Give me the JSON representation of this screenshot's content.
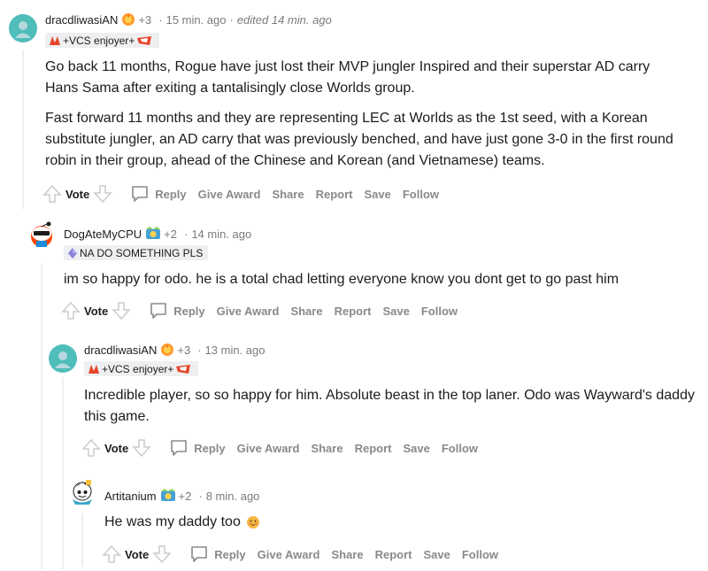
{
  "comments": [
    {
      "author": "dracdliwasiAN",
      "karma": "+3",
      "time": "15 min. ago",
      "edited": "edited 14 min. ago",
      "flair": "+VCS enjoyer+",
      "paragraphs": [
        "Go back 11 months, Rogue have just lost their MVP jungler Inspired and their superstar AD carry Hans Sama after exiting a tantalisingly close Worlds group.",
        "Fast forward 11 months and they are representing LEC at Worlds as the 1st seed, with a Korean substitute jungler, an AD carry that was previously benched, and have just gone 3-0 in the first round robin in their group, ahead of the Chinese and Korean (and Vietnamese) teams."
      ]
    },
    {
      "author": "DogAteMyCPU",
      "karma": "+2",
      "time": "14 min. ago",
      "flair": "NA DO SOMETHING PLS",
      "paragraphs": [
        "im so happy for odo. he is a total chad letting everyone know you dont get to go past him"
      ]
    },
    {
      "author": "dracdliwasiAN",
      "karma": "+3",
      "time": "13 min. ago",
      "flair": "+VCS enjoyer+",
      "paragraphs": [
        "Incredible player, so so happy for him. Absolute beast in the top laner. Odo was Wayward's daddy this game."
      ]
    },
    {
      "author": "Artitanium",
      "karma": "+2",
      "time": "8 min. ago",
      "paragraphs": [
        "He was my daddy too"
      ]
    }
  ],
  "actions": {
    "vote": "Vote",
    "reply": "Reply",
    "give_award": "Give Award",
    "share": "Share",
    "report": "Report",
    "save": "Save",
    "follow": "Follow"
  },
  "separator": "·",
  "colors": {
    "meta": "#787c7e",
    "action": "#878a8c",
    "thread": "#edeff1",
    "flair_bg": "#edeff1"
  }
}
